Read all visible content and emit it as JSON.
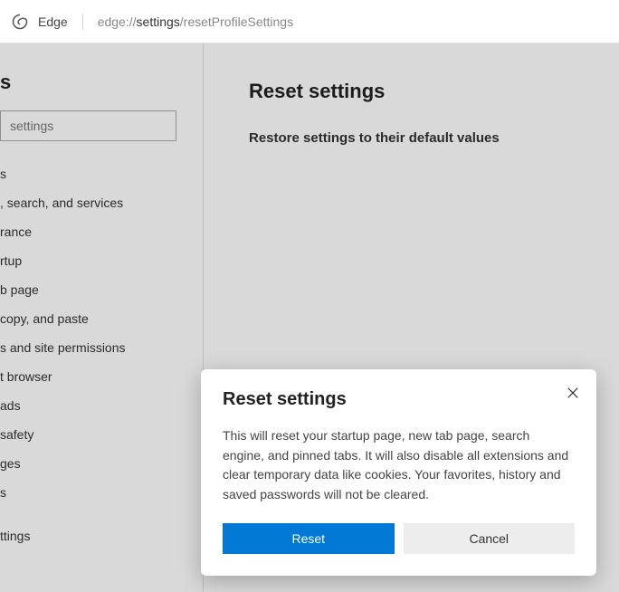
{
  "address_bar": {
    "app_label": "Edge",
    "url_prefix": "edge://",
    "url_highlight": "settings",
    "url_suffix": "/resetProfileSettings"
  },
  "sidebar": {
    "heading": "s",
    "search_placeholder": "settings",
    "items": [
      {
        "label": "s"
      },
      {
        "label": ", search, and services"
      },
      {
        "label": "rance"
      },
      {
        "label": "rtup"
      },
      {
        "label": "b page"
      },
      {
        "label": "copy, and paste"
      },
      {
        "label": "s and site permissions"
      },
      {
        "label": "t browser"
      },
      {
        "label": "ads"
      },
      {
        "label": "safety"
      },
      {
        "label": "ges"
      },
      {
        "label": "s"
      },
      {
        "label": ""
      },
      {
        "label": "ttings"
      }
    ]
  },
  "content": {
    "title": "Reset settings",
    "subtitle": "Restore settings to their default values"
  },
  "dialog": {
    "title": "Reset settings",
    "body": "This will reset your startup page, new tab page, search engine, and pinned tabs. It will also disable all extensions and clear temporary data like cookies. Your favorites, history and saved passwords will not be cleared.",
    "primary_label": "Reset",
    "secondary_label": "Cancel"
  }
}
